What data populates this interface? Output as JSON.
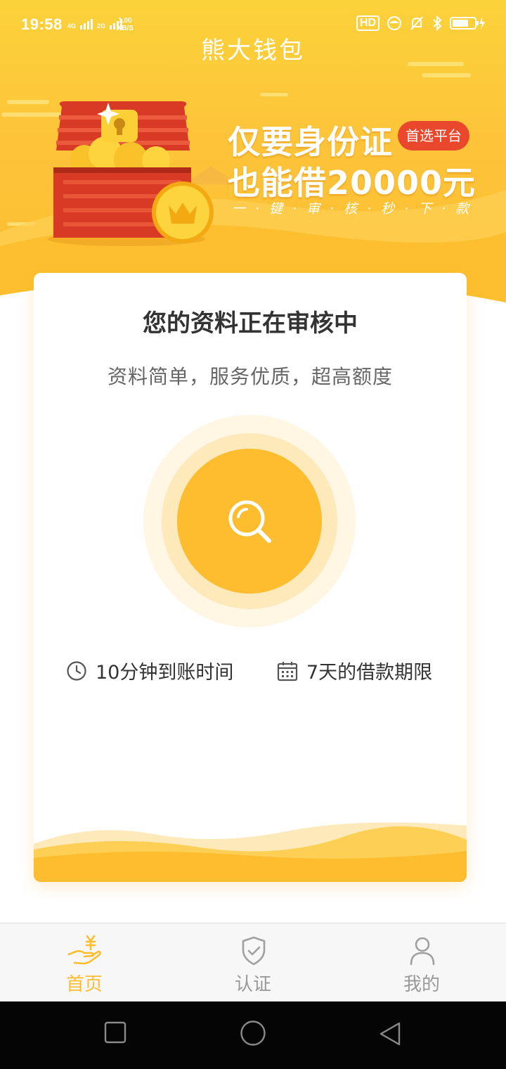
{
  "status_bar": {
    "time": "19:58",
    "network_1": "4G",
    "network_2": "2G",
    "speed_value": "1.00",
    "speed_unit": "KB/S",
    "hd_label": "HD"
  },
  "header": {
    "title": "熊大钱包"
  },
  "banner": {
    "line1": "仅要身份证",
    "badge": "首选平台",
    "line2": "也能借20000元",
    "line3": "一·键·审·核·秒·下·款"
  },
  "card": {
    "title": "您的资料正在审核中",
    "subtitle": "资料简单，服务优质，超高额度",
    "info_left": "10分钟到账时间",
    "info_right": "7天的借款期限"
  },
  "tabs": [
    {
      "label": "首页",
      "icon": "hand-yen-icon",
      "active": true
    },
    {
      "label": "认证",
      "icon": "shield-check-icon",
      "active": false
    },
    {
      "label": "我的",
      "icon": "user-icon",
      "active": false
    }
  ],
  "colors": {
    "primary": "#fdbd2f",
    "badge": "#e9482d",
    "text_dark": "#333333",
    "text_muted": "#666666",
    "tab_inactive": "#999999"
  }
}
